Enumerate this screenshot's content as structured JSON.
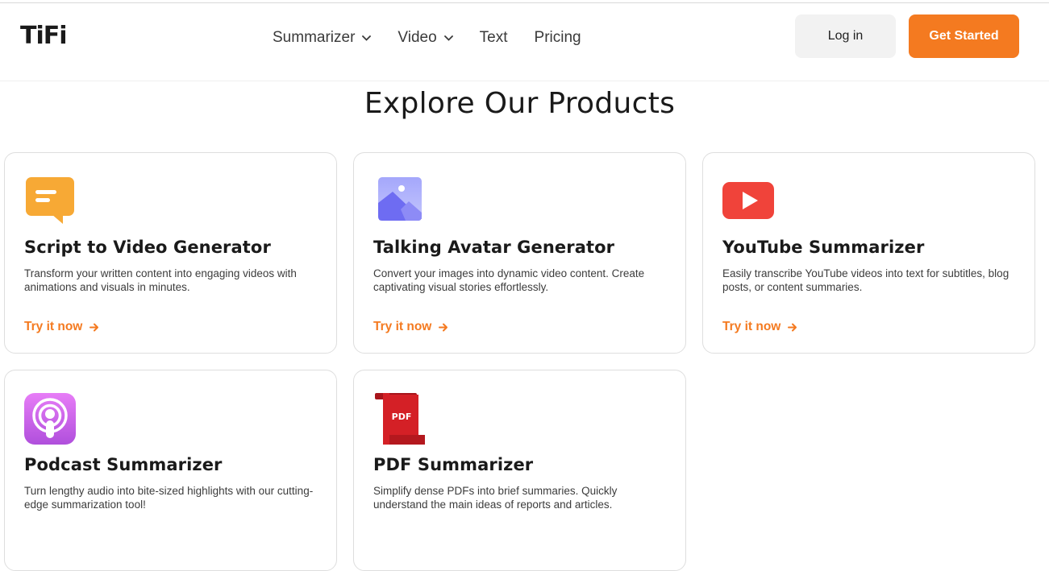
{
  "header": {
    "logo_text": "TiFi",
    "nav": [
      {
        "label": "Summarizer",
        "has_dropdown": true
      },
      {
        "label": "Video",
        "has_dropdown": true
      },
      {
        "label": "Text",
        "has_dropdown": false
      },
      {
        "label": "Pricing",
        "has_dropdown": false
      }
    ],
    "login_label": "Log in",
    "cta_label": "Get Started"
  },
  "main": {
    "title": "Explore Our Products",
    "products": [
      {
        "title": "Script to Video Generator",
        "description": "Transform your written content into engaging videos with animations and visuals in minutes.",
        "cta": "Try it now",
        "icon": "chat-bubble-icon"
      },
      {
        "title": "Talking Avatar Generator",
        "description": "Convert your images into dynamic video content. Create captivating visual stories effortlessly.",
        "cta": "Try it now",
        "icon": "image-icon"
      },
      {
        "title": "YouTube Summarizer",
        "description": "Easily transcribe YouTube videos into text for subtitles, blog posts, or content summaries.",
        "cta": "Try it now",
        "icon": "youtube-icon"
      },
      {
        "title": "Podcast Summarizer",
        "description": "Turn lengthy audio into bite-sized highlights with our cutting-edge summarization tool!",
        "cta": "Try it now",
        "icon": "podcast-icon"
      },
      {
        "title": "PDF Summarizer",
        "description": "Simplify dense PDFs into brief summaries. Quickly understand the main ideas of reports and articles.",
        "cta": "Try it now",
        "icon": "pdf-icon",
        "icon_text": "PDF"
      }
    ]
  },
  "colors": {
    "accent": "#f47a20",
    "youtube": "#f0433a",
    "podcast": "#c45ce0",
    "pdf": "#d42026",
    "image": "#6e6cf2"
  }
}
